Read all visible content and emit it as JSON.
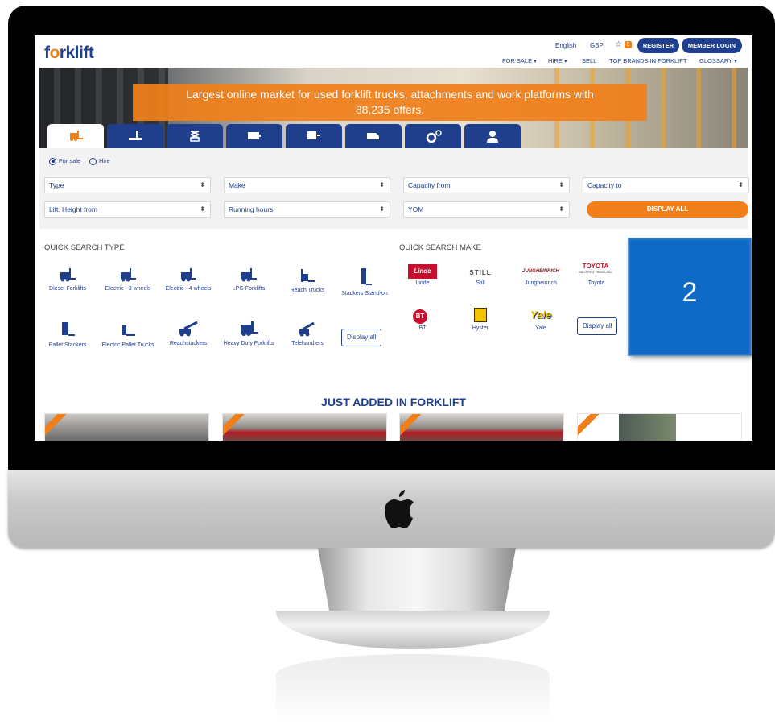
{
  "header": {
    "logo_part1": "f",
    "logo_o": "o",
    "logo_part2": "rklift",
    "language": "English",
    "currency": "GBP",
    "favorites_count": "0",
    "register": "REGISTER",
    "member_login": "MEMBER LOGIN"
  },
  "nav": {
    "for_sale": "FOR SALE ▾",
    "hire": "HIRE ▾",
    "sell": "SELL",
    "top_brands": "TOP BRANDS IN FORKLIFT",
    "glossary": "GLOSSARY ▾"
  },
  "hero": {
    "line1": "Largest online market for used forklift trucks, attachments and work platforms with",
    "line2": "88,235 offers."
  },
  "filters": {
    "for_sale": "For sale",
    "hire": "Hire",
    "type": "Type",
    "make": "Make",
    "capacity_from": "Capacity from",
    "capacity_to": "Capacity to",
    "lift_height_from": "Lift. Height from",
    "running_hours": "Running hours",
    "yom": "YOM",
    "display_all": "DISPLAY ALL"
  },
  "quick_search_type": {
    "title": "QUICK SEARCH TYPE",
    "items": [
      "Diesel Forklifts",
      "Electric - 3 wheels",
      "Electric - 4 wheels",
      "LPG Forklifts",
      "Reach Trucks",
      "Stackers Stand-on",
      "Pallet Stackers",
      "Electric Pallet Trucks",
      "Reachstackers",
      "Heavy Duty Forklifts",
      "Telehandlers"
    ],
    "display_all": "Display all"
  },
  "quick_search_make": {
    "title": "QUICK SEARCH MAKE",
    "items": [
      "Linde",
      "Still",
      "Jungheinrich",
      "Toyota",
      "BT",
      "Hyster",
      "Yale"
    ],
    "logos": {
      "linde": "Linde",
      "still": "STILL",
      "jungheinrich": "JUNGHEINRICH",
      "toyota": "TOYOTA",
      "toyota_sub": "MATERIAL HANDLING",
      "bt": "BT",
      "yale": "Yale"
    },
    "display_all": "Display all"
  },
  "just_added": {
    "title": "JUST ADDED IN FORKLIFT"
  },
  "overlay": {
    "label": "2"
  },
  "colors": {
    "brand_blue": "#1f3e8c",
    "accent_orange": "#f07f1a",
    "overlay_blue": "#0f6ac5"
  }
}
